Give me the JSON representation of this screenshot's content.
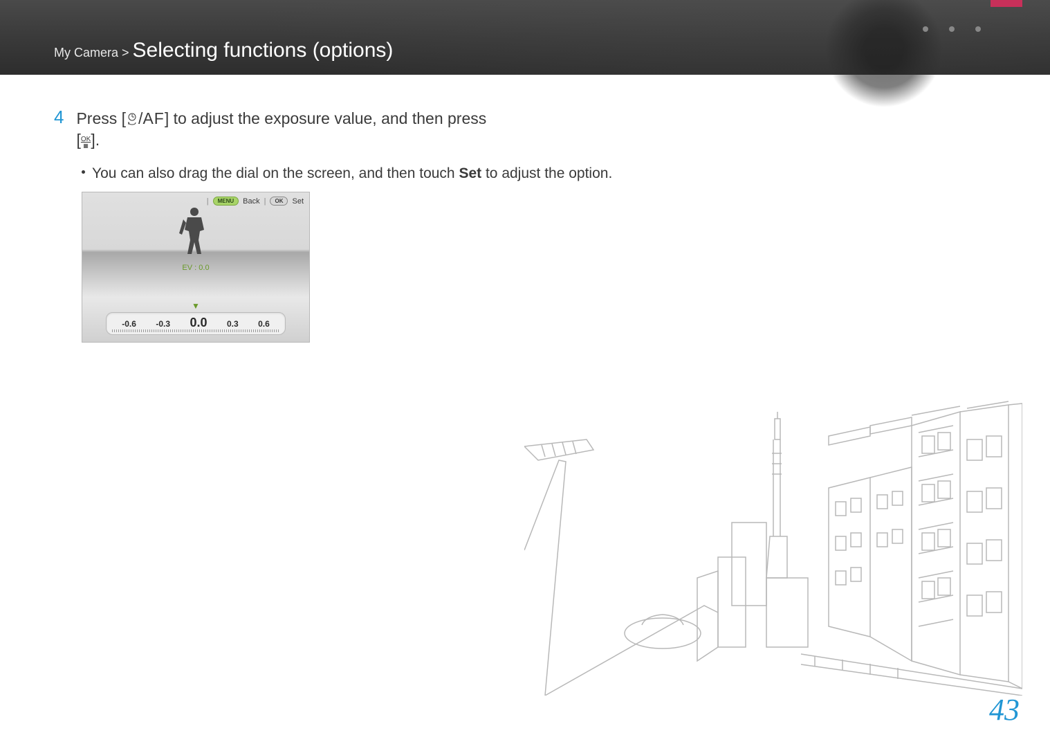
{
  "header": {
    "breadcrumb_prefix": "My Camera",
    "breadcrumb_sep": " > ",
    "title": "Selecting functions (options)"
  },
  "step": {
    "number": "4",
    "text_part1": "Press [",
    "text_part2": "/",
    "af_label": "AF",
    "text_part3": "] to adjust the exposure value, and then press",
    "line2_open": "[",
    "ok_top": "OK",
    "ok_bottom": "⊞",
    "line2_close": "]."
  },
  "bullet": {
    "text_part1": "You can also drag the dial on the screen, and then touch ",
    "set_word": "Set",
    "text_part2": " to adjust the option."
  },
  "screenshot": {
    "menu_pill": "MENU",
    "back_label": "Back",
    "ok_pill": "OK",
    "set_label": "Set",
    "ev_label": "EV : 0.0",
    "dial_values": [
      "-0.6",
      "-0.3",
      "0.0",
      "0.3",
      "0.6"
    ]
  },
  "page_number": "43"
}
